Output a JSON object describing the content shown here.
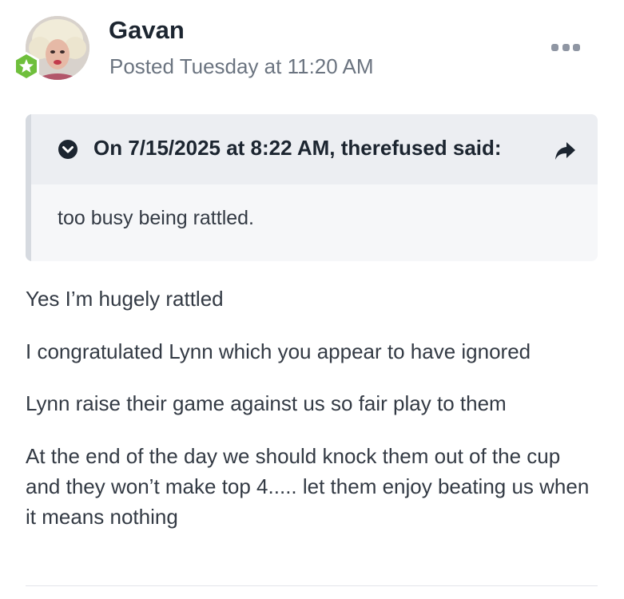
{
  "post": {
    "author": "Gavan",
    "date": "Posted Tuesday at 11:20 AM",
    "avatar_icon": "avatar-photo",
    "badge_icon": "star-rank-badge",
    "badge_color": "#6fbf3c",
    "more_icon": "ellipsis-icon",
    "quote": {
      "citation": "On 7/15/2025 at 8:22 AM, therefused said:",
      "text": "too busy being rattled.",
      "toggle_icon": "chevron-down-circle-icon",
      "share_icon": "share-arrow-icon"
    },
    "paragraphs": [
      "Yes I’m hugely rattled",
      "I congratulated Lynn which you appear to have ignored",
      "Lynn raise their game against us so fair play to them",
      "At the end of the day we should knock them out of the cup and they won’t make top 4..... let them enjoy beating us when it means nothing"
    ]
  }
}
